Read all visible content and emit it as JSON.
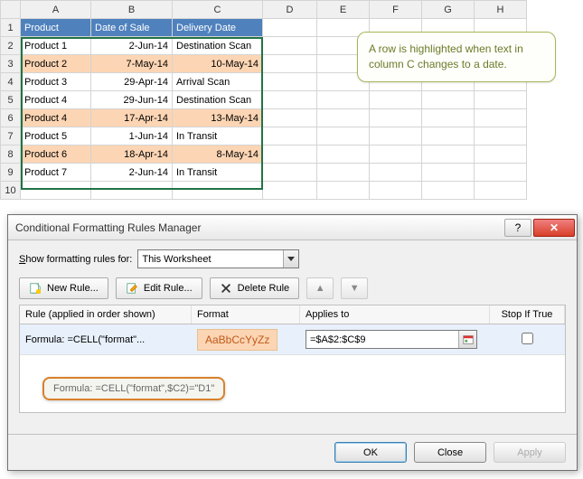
{
  "sheet": {
    "columns": [
      "A",
      "B",
      "C",
      "D",
      "E",
      "F",
      "G",
      "H"
    ],
    "headers": {
      "A": "Product",
      "B": "Date of Sale",
      "C": "Delivery Date"
    },
    "rows": [
      {
        "n": 1
      },
      {
        "n": 2,
        "A": "Product 1",
        "B": "2-Jun-14",
        "C": "Destination Scan",
        "hl": false
      },
      {
        "n": 3,
        "A": "Product 2",
        "B": "7-May-14",
        "C": "10-May-14",
        "hl": true,
        "cRight": true
      },
      {
        "n": 4,
        "A": "Product 3",
        "B": "29-Apr-14",
        "C": "Arrival Scan",
        "hl": false
      },
      {
        "n": 5,
        "A": "Product 4",
        "B": "29-Jun-14",
        "C": "Destination Scan",
        "hl": false
      },
      {
        "n": 6,
        "A": "Product 4",
        "B": "17-Apr-14",
        "C": "13-May-14",
        "hl": true,
        "cRight": true
      },
      {
        "n": 7,
        "A": "Product 5",
        "B": "1-Jun-14",
        "C": "In Transit",
        "hl": false
      },
      {
        "n": 8,
        "A": "Product 6",
        "B": "18-Apr-14",
        "C": "8-May-14",
        "hl": true,
        "cRight": true
      },
      {
        "n": 9,
        "A": "Product 7",
        "B": "2-Jun-14",
        "C": "In Transit",
        "hl": false
      },
      {
        "n": 10
      }
    ]
  },
  "callout": "A row is highlighted when text in column C changes to a date.",
  "dialog": {
    "title": "Conditional Formatting Rules Manager",
    "show_label": "Show formatting rules for:",
    "scope": "This Worksheet",
    "buttons": {
      "new": "New Rule...",
      "edit": "Edit Rule...",
      "delete": "Delete Rule"
    },
    "grid": {
      "h1": "Rule (applied in order shown)",
      "h2": "Format",
      "h3": "Applies to",
      "h4": "Stop If True",
      "rule_text": "Formula: =CELL(\"format\"...",
      "format_preview": "AaBbCcYyZz",
      "applies_to": "=$A$2:$C$9"
    },
    "tooltip": "Formula: =CELL(\"format\",$C2)=\"D1\"",
    "footer": {
      "ok": "OK",
      "close": "Close",
      "apply": "Apply"
    }
  }
}
